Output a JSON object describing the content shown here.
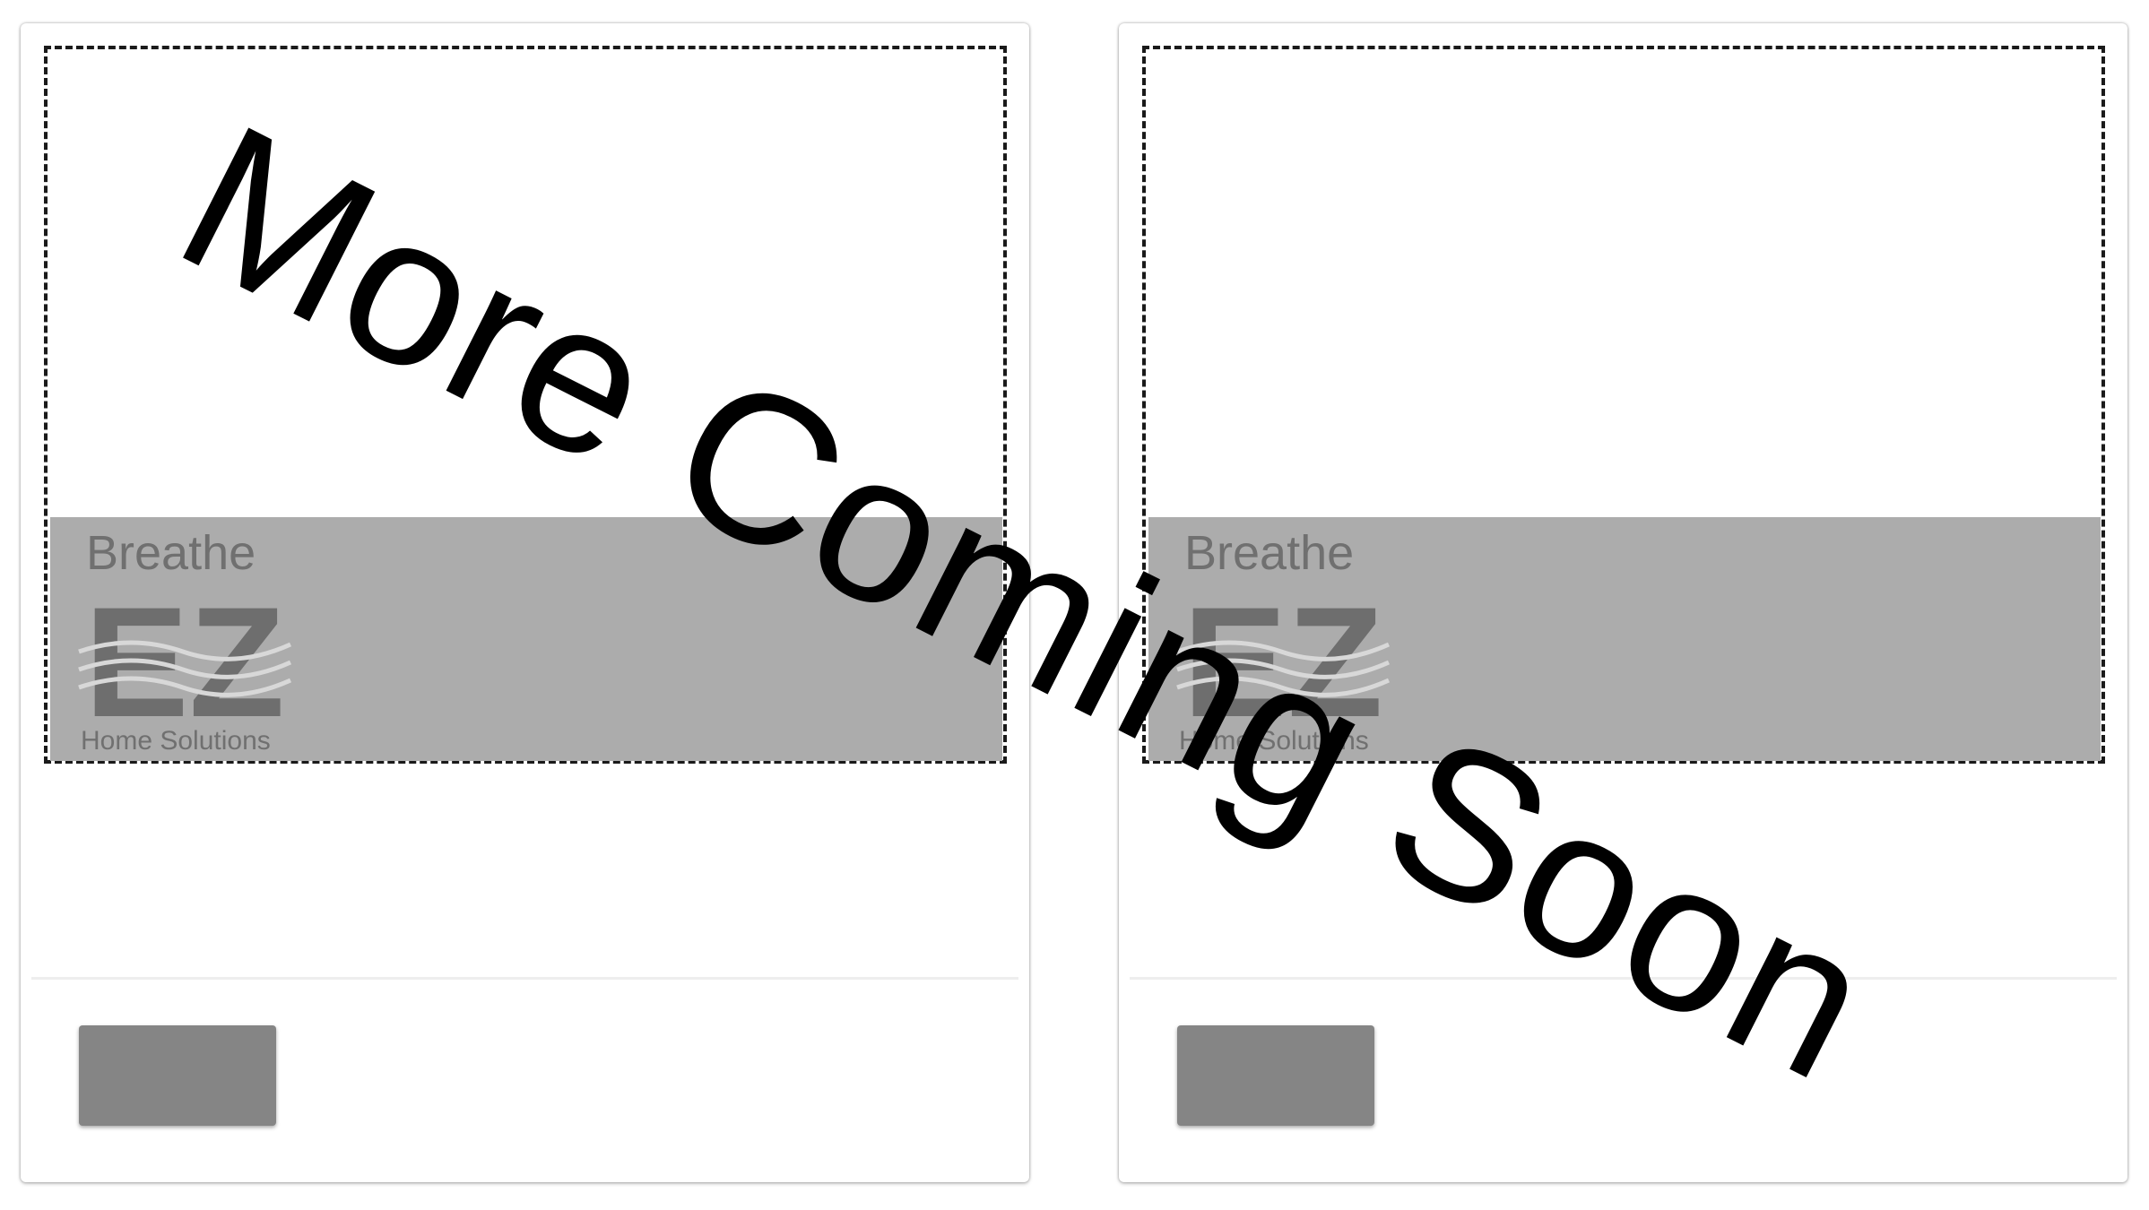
{
  "cards": [
    {
      "logo": {
        "line1": "Breathe",
        "mark": "EZ",
        "line3": "Home Solutions"
      },
      "button_label": ""
    },
    {
      "logo": {
        "line1": "Breathe",
        "mark": "EZ",
        "line3": "Home Solutions"
      },
      "button_label": ""
    }
  ],
  "overlay_text": "More Coming Soon",
  "colors": {
    "background": "#ffffff",
    "logo_band": "#acacac",
    "button": "#858585",
    "dashed_border": "#1a1a1a",
    "overlay_text": "#000000"
  }
}
